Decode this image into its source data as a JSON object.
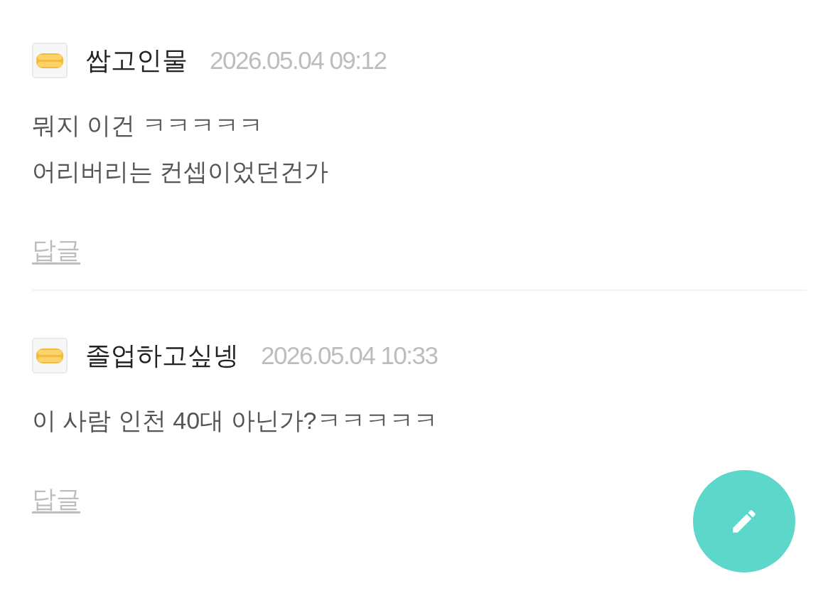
{
  "comments": [
    {
      "author": "쌉고인물",
      "time": "2026.05.04 09:12",
      "text": "뭐지 이건 ㅋㅋㅋㅋㅋ\n어리버리는 컨셉이었던건가",
      "reply_label": "답글"
    },
    {
      "author": "졸업하고싶넹",
      "time": "2026.05.04 10:33",
      "text": "이 사람 인천 40대 아닌가?ㅋㅋㅋㅋㅋ",
      "reply_label": "답글"
    }
  ]
}
